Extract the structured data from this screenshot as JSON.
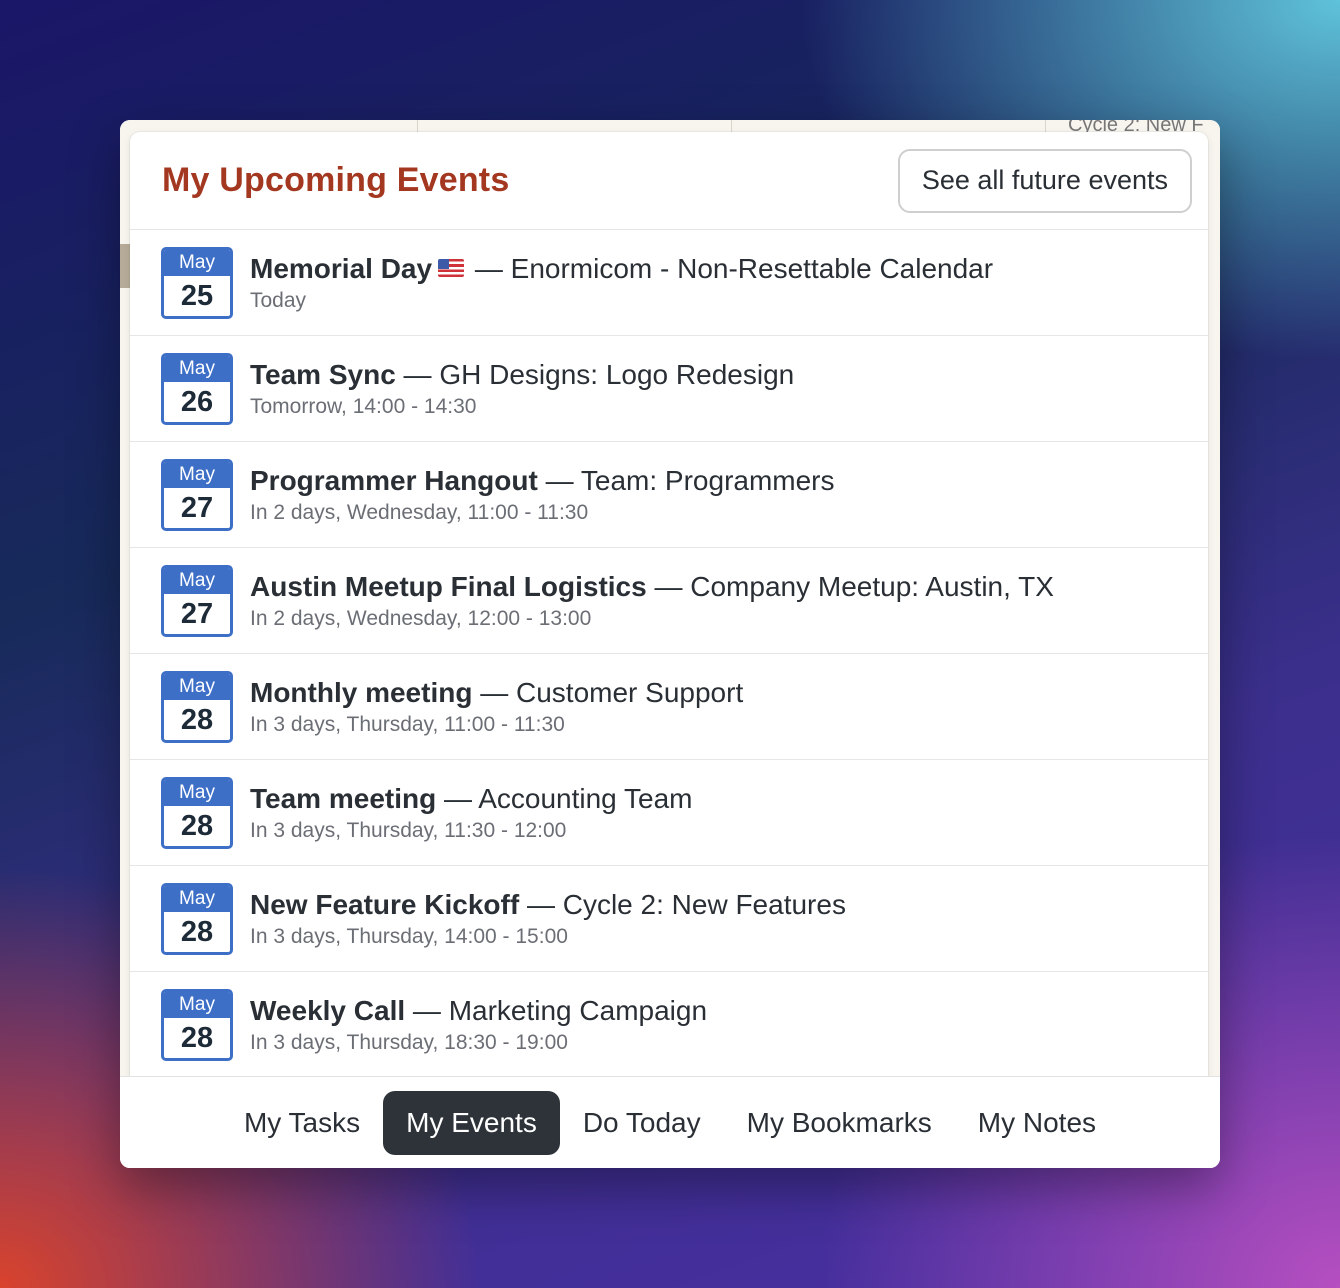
{
  "popup": {
    "title": "My Upcoming Events",
    "see_all_label": "See all future events"
  },
  "events": [
    {
      "month": "May",
      "day": "25",
      "name": "Memorial Day",
      "flag": "us-flag-icon",
      "separator": " — ",
      "group": "Enormicom - Non-Resettable Calendar",
      "when": "Today"
    },
    {
      "month": "May",
      "day": "26",
      "name": "Team Sync",
      "separator": " — ",
      "group": "GH Designs: Logo Redesign",
      "when": "Tomorrow, 14:00 - 14:30"
    },
    {
      "month": "May",
      "day": "27",
      "name": "Programmer Hangout",
      "separator": " — ",
      "group": "Team: Programmers",
      "when": "In 2 days, Wednesday, 11:00 - 11:30"
    },
    {
      "month": "May",
      "day": "27",
      "name": "Austin Meetup Final Logistics",
      "separator": " — ",
      "group": "Company Meetup: Austin, TX",
      "when": "In 2 days, Wednesday, 12:00 - 13:00"
    },
    {
      "month": "May",
      "day": "28",
      "name": "Monthly meeting",
      "separator": " — ",
      "group": "Customer Support",
      "when": "In 3 days, Thursday, 11:00 - 11:30"
    },
    {
      "month": "May",
      "day": "28",
      "name": "Team meeting",
      "separator": " — ",
      "group": "Accounting Team",
      "when": "In 3 days, Thursday, 11:30 - 12:00"
    },
    {
      "month": "May",
      "day": "28",
      "name": "New Feature Kickoff",
      "separator": " — ",
      "group": "Cycle 2: New Features",
      "when": "In 3 days, Thursday, 14:00 - 15:00"
    },
    {
      "month": "May",
      "day": "28",
      "name": "Weekly Call",
      "separator": " — ",
      "group": "Marketing Campaign",
      "when": "In 3 days, Thursday, 18:30 - 19:00"
    }
  ],
  "nav": {
    "tabs": [
      {
        "label": "My Tasks",
        "active": false
      },
      {
        "label": "My Events",
        "active": true
      },
      {
        "label": "Do Today",
        "active": false
      },
      {
        "label": "My Bookmarks",
        "active": false
      },
      {
        "label": "My Notes",
        "active": false
      }
    ]
  },
  "background": {
    "peek_text": "Cycle 2: New F"
  },
  "colors": {
    "title": "#a3371f",
    "badge": "#3d6fc7",
    "active_tab": "#2d3338"
  }
}
